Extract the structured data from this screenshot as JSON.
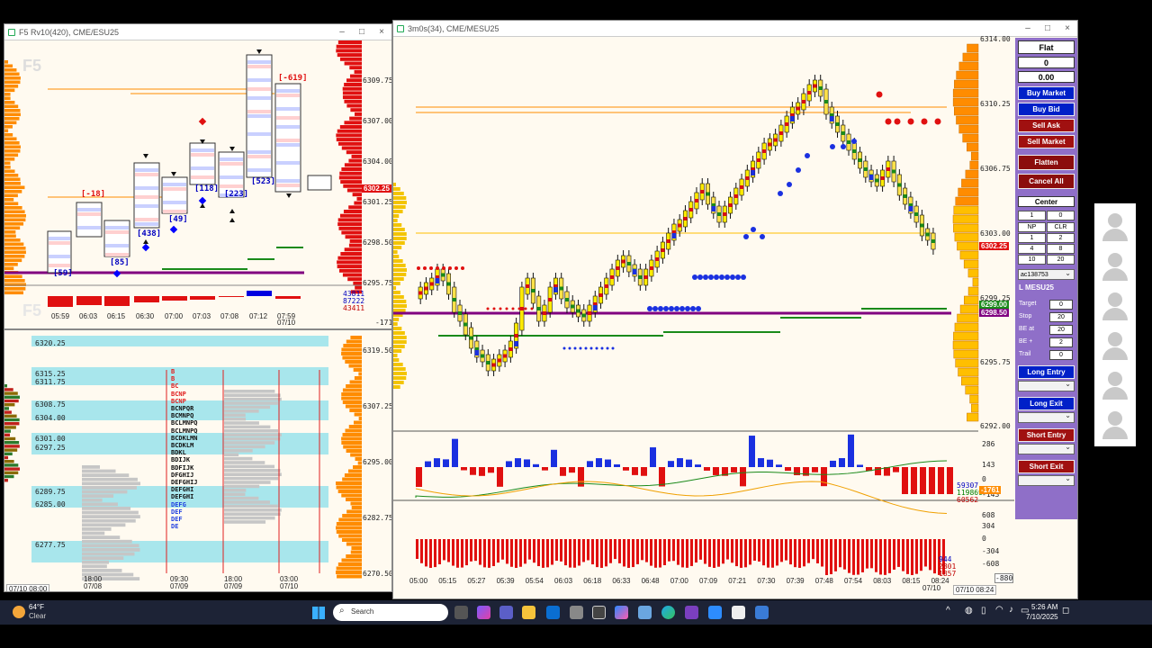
{
  "colors": {
    "bg": "#fffaf0",
    "bull": "#ffeb00",
    "bear": "#ff0000",
    "blue": "#0000ff",
    "purple": "#800080",
    "green": "#1a8a1a",
    "orange": "#ff8c00",
    "panel": "#8f6fc8"
  },
  "left_top": {
    "title": "F5 Rv10(420), CME/ESU25",
    "watermark": "F5",
    "watermark2": "F5",
    "prices": [
      "6309.75",
      "6307.00",
      "6304.00",
      "6301.25",
      "6298.50",
      "6295.75"
    ],
    "current_price": "6302.25",
    "box_labels": [
      "[59]",
      "[-18]",
      "[85]",
      "[438]",
      "[49]",
      "[118]",
      "[223]",
      "[523]",
      "[-619]"
    ],
    "times": [
      "05:59",
      "06:03",
      "06:15",
      "06:30",
      "07:00",
      "07:03",
      "07:08",
      "07:12",
      "07:59"
    ],
    "date": "07/10",
    "vol_readout": [
      "43811",
      "87222",
      "43411"
    ],
    "small_neg": "-1717"
  },
  "left_bottom": {
    "levels": [
      "6320.25",
      "6315.25",
      "6311.75",
      "6308.75",
      "6304.00",
      "6301.00",
      "6297.25",
      "6289.75",
      "6285.00",
      "6277.75"
    ],
    "prices": [
      "6319.50",
      "6307.25",
      "6295.00",
      "6282.75",
      "6270.50"
    ],
    "times": [
      {
        "t": "18:00",
        "d": "07/08"
      },
      {
        "t": "09:30",
        "d": "07/09"
      },
      {
        "t": "18:00",
        "d": "07/09"
      },
      {
        "t": "03:00",
        "d": "07/10"
      }
    ],
    "stamp": "07/10 08:00",
    "letters": [
      "B",
      "B",
      "BC",
      "BCNP",
      "BCNP",
      "BCNPQR",
      "BCMNPQ",
      "BCLMNPQ",
      "BCLMNPQ",
      "BCDKLMN",
      "BCDKLM",
      "BDKL",
      "BDIJK",
      "BDFIJK",
      "DFGHIJ",
      "DEFGHIJ",
      "DEFGHI",
      "DEFGHI",
      "DEFG",
      "DEF",
      "DEF",
      "DE"
    ]
  },
  "main": {
    "title": "3m0s(34), CME/MESU25",
    "prices": [
      "6314.00",
      "6310.25",
      "6306.75",
      "6303.00",
      "6299.25",
      "6295.75",
      "6292.00"
    ],
    "current_price": "6302.25",
    "price_green": "6299.00",
    "price_purple": "6298.50",
    "osc_labels": [
      "286",
      "143",
      "0",
      "-143"
    ],
    "osc_readout": [
      "59307",
      "119869",
      "60562"
    ],
    "osc_tag": "-1761",
    "vol_labels": [
      "608",
      "304",
      "0",
      "-304",
      "-608"
    ],
    "vol_readout": [
      "944",
      "2801",
      "1857"
    ],
    "vol_tag": "-880",
    "times": [
      "05:00",
      "05:15",
      "05:27",
      "05:39",
      "05:54",
      "06:03",
      "06:18",
      "06:33",
      "06:48",
      "07:00",
      "07:09",
      "07:21",
      "07:30",
      "07:39",
      "07:48",
      "07:54",
      "08:03",
      "08:15",
      "08:24"
    ],
    "date": "07/10",
    "stamp": "07/10 08:24"
  },
  "order_panel": {
    "position": "Flat",
    "qty": "0",
    "pnl": "0.00",
    "buy_market": "Buy Market",
    "buy_bid": "Buy Bid",
    "sell_ask": "Sell Ask",
    "sell_market": "Sell Market",
    "flatten": "Flatten",
    "cancel_all": "Cancel All",
    "center": "Center",
    "qty_input": "1",
    "qty_right": "0",
    "grid": [
      "NP",
      "CLR",
      "1",
      "2",
      "4",
      "8",
      "10",
      "20"
    ],
    "account": "ac138753",
    "symbol": "L MESU25",
    "target_label": "Target",
    "target": "0",
    "stop_label": "Stop",
    "stop": "20",
    "beat_label": "BE at",
    "beat": "20",
    "beplus_label": "BE +",
    "beplus": "2",
    "trail_label": "Trail",
    "trail": "0",
    "long_entry": "Long Entry",
    "long_exit": "Long Exit",
    "short_entry": "Short Entry",
    "short_exit": "Short Exit"
  },
  "taskbar": {
    "weather_temp": "64°F",
    "weather_desc": "Clear",
    "search": "Search",
    "time": "5:26 AM",
    "date": "7/10/2025"
  }
}
